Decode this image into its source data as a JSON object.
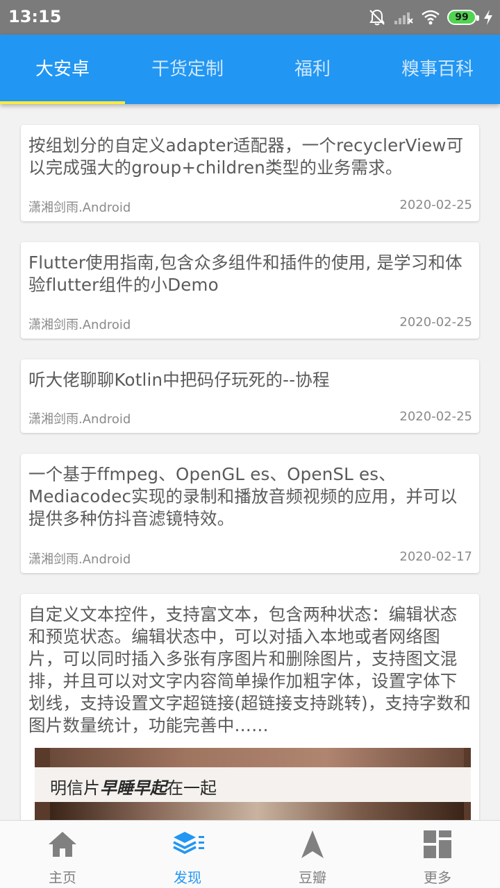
{
  "statusbar": {
    "time": "13:15",
    "battery": "99",
    "icons": [
      "mute-bell-icon",
      "signal-icon",
      "wifi-icon",
      "battery-icon",
      "charging-icon"
    ]
  },
  "tabs": [
    {
      "label": "大安卓",
      "active": true
    },
    {
      "label": "干货定制",
      "active": false
    },
    {
      "label": "福利",
      "active": false
    },
    {
      "label": "糗事百科",
      "active": false
    }
  ],
  "articles": [
    {
      "title": "按组划分的自定义adapter适配器，一个recyclerView可以完成强大的group+children类型的业务需求。",
      "author": "潇湘剑雨.Android",
      "date": "2020-02-25"
    },
    {
      "title": "Flutter使用指南,包含众多组件和插件的使用, 是学习和体验flutter组件的小Demo",
      "author": "潇湘剑雨.Android",
      "date": "2020-02-25"
    },
    {
      "title": "听大佬聊聊Kotlin中把码仔玩死的--协程",
      "author": "潇湘剑雨.Android",
      "date": "2020-02-25"
    },
    {
      "title": "一个基于ffmpeg、OpenGL es、OpenSL es、Mediacodec实现的录制和播放音频视频的应用，并可以提供多种仿抖音滤镜特效。",
      "author": "潇湘剑雨.Android",
      "date": "2020-02-17"
    },
    {
      "title": "自定义文本控件，支持富文本，包含两种状态：编辑状态和预览状态。编辑状态中，可以对插入本地或者网络图片，可以同时插入多张有序图片和删除图片，支持图文混排，并且可以对文字内容简单操作加粗字体，设置字体下划线，支持设置文字超链接(超链接支持跳转)，支持字数和图片数量统计，功能完善中……",
      "image_text_prefix": "明信片",
      "image_text_emphasis": "早睡早起",
      "image_text_suffix": "在一起"
    }
  ],
  "bottomnav": [
    {
      "label": "主页",
      "icon": "home-icon",
      "active": false
    },
    {
      "label": "发现",
      "icon": "layers-icon",
      "active": true
    },
    {
      "label": "豆瓣",
      "icon": "navigation-arrow-icon",
      "active": false
    },
    {
      "label": "更多",
      "icon": "grid-icon",
      "active": false
    }
  ],
  "colors": {
    "primary": "#2196f3",
    "indicator": "#ffeb3b",
    "statusbar": "#7b7b7b"
  }
}
